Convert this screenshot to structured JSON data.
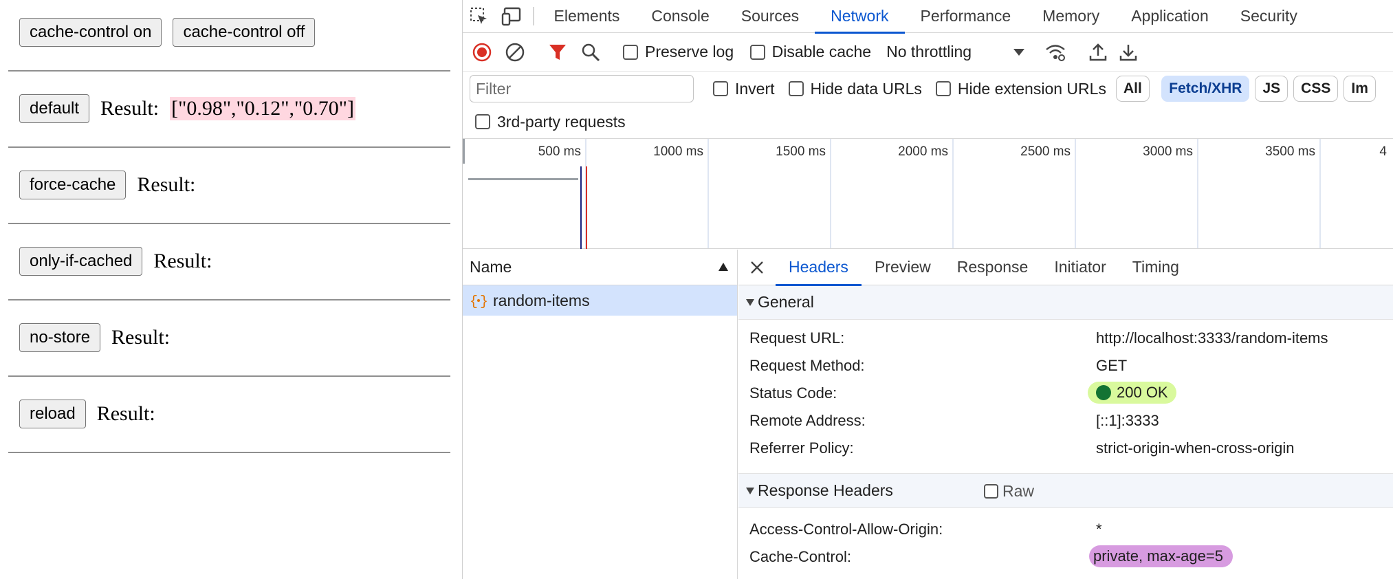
{
  "page": {
    "rows": [
      {
        "buttons": [
          "cache-control on",
          "cache-control off"
        ]
      },
      {
        "button": "default",
        "result_label": "Result:",
        "result_value": "[\"0.98\",\"0.12\",\"0.70\"]"
      },
      {
        "button": "force-cache",
        "result_label": "Result:"
      },
      {
        "button": "only-if-cached",
        "result_label": "Result:"
      },
      {
        "button": "no-store",
        "result_label": "Result:"
      },
      {
        "button": "reload",
        "result_label": "Result:"
      }
    ]
  },
  "devtools": {
    "tabs": [
      "Elements",
      "Console",
      "Sources",
      "Network",
      "Performance",
      "Memory",
      "Application",
      "Security"
    ],
    "active_tab": "Network",
    "toolbar": {
      "preserve_log": "Preserve log",
      "disable_cache": "Disable cache",
      "throttling": "No throttling"
    },
    "filterbar": {
      "filter_placeholder": "Filter",
      "invert": "Invert",
      "hide_data_urls": "Hide data URLs",
      "hide_extension_urls": "Hide extension URLs",
      "pills": [
        "All",
        "Fetch/XHR",
        "JS",
        "CSS",
        "Im"
      ],
      "selected_pill": "Fetch/XHR",
      "third_party": "3rd-party requests"
    },
    "timeline": {
      "ticks": [
        "500 ms",
        "1000 ms",
        "1500 ms",
        "2000 ms",
        "2500 ms",
        "3000 ms",
        "3500 ms",
        "4"
      ]
    },
    "requests": {
      "name_header": "Name",
      "items": [
        "random-items"
      ]
    },
    "details": {
      "tabs": [
        "Headers",
        "Preview",
        "Response",
        "Initiator",
        "Timing"
      ],
      "active_tab": "Headers",
      "general_title": "General",
      "general": [
        {
          "key": "Request URL:",
          "value": "http://localhost:3333/random-items"
        },
        {
          "key": "Request Method:",
          "value": "GET"
        },
        {
          "key": "Status Code:",
          "value": "200 OK"
        },
        {
          "key": "Remote Address:",
          "value": "[::1]:3333"
        },
        {
          "key": "Referrer Policy:",
          "value": "strict-origin-when-cross-origin"
        }
      ],
      "response_headers_title": "Response Headers",
      "raw_label": "Raw",
      "response_headers": [
        {
          "key": "Access-Control-Allow-Origin:",
          "value": "*"
        },
        {
          "key": "Cache-Control:",
          "value": "private, max-age=5"
        }
      ]
    }
  },
  "colors": {
    "accent": "#0b57d0",
    "record_red": "#d93025",
    "status_green": "#137333",
    "result_highlight": "#ffd7e0",
    "cache_control_highlight": "#d79be0"
  }
}
